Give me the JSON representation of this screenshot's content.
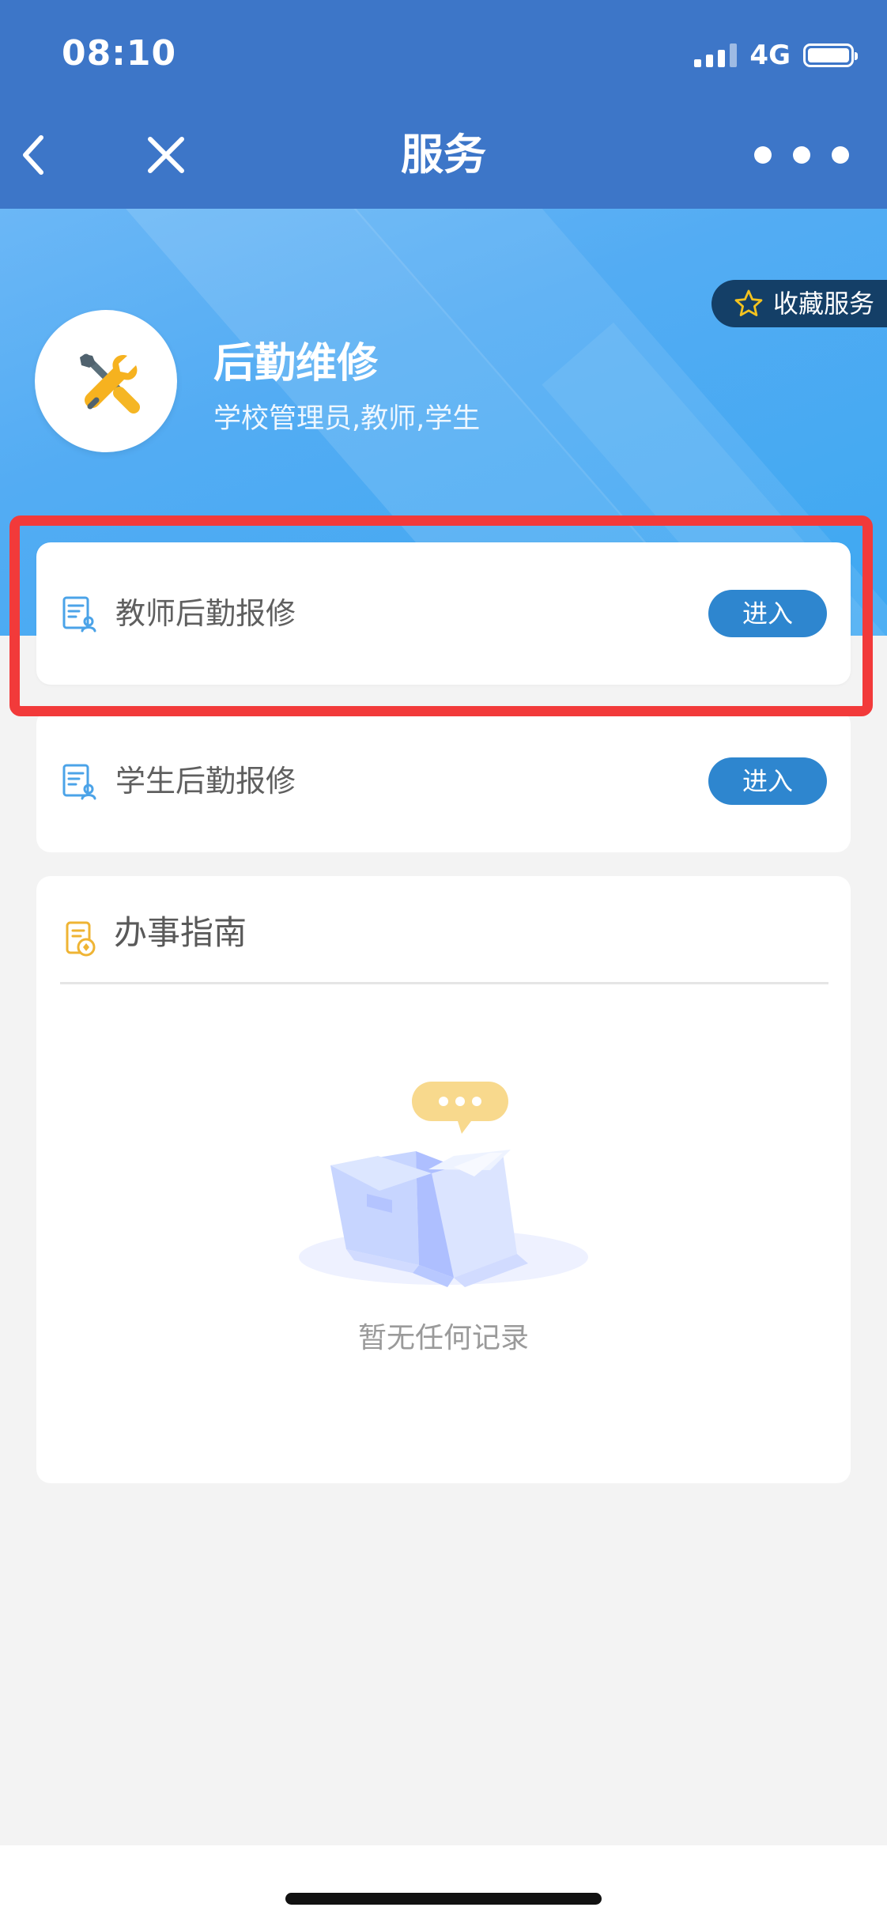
{
  "status_bar": {
    "time": "08:10",
    "network": "4G"
  },
  "nav": {
    "title": "服务",
    "back_icon": "chevron-left-icon",
    "close_icon": "close-icon",
    "more_icon": "more-horizontal-icon"
  },
  "hero": {
    "favorite_label": "收藏服务",
    "favorite_icon": "star-outline-icon",
    "service_icon": "tools-icon",
    "service_title": "后勤维修",
    "audience": "学校管理员,教师,学生"
  },
  "services": [
    {
      "label": "教师后勤报修",
      "button": "进入",
      "icon": "document-user-icon"
    },
    {
      "label": "学生后勤报修",
      "button": "进入",
      "icon": "document-user-icon"
    }
  ],
  "guide": {
    "title": "办事指南",
    "icon": "guide-document-icon",
    "empty_text": "暂无任何记录",
    "empty_icon": "empty-box-icon"
  },
  "colors": {
    "topbar": "#3d76c8",
    "hero": "#4aaef3",
    "favorite_bg": "#143f67",
    "button": "#2e86cf",
    "highlight": "#f23a3a",
    "background": "#f3f3f3"
  }
}
